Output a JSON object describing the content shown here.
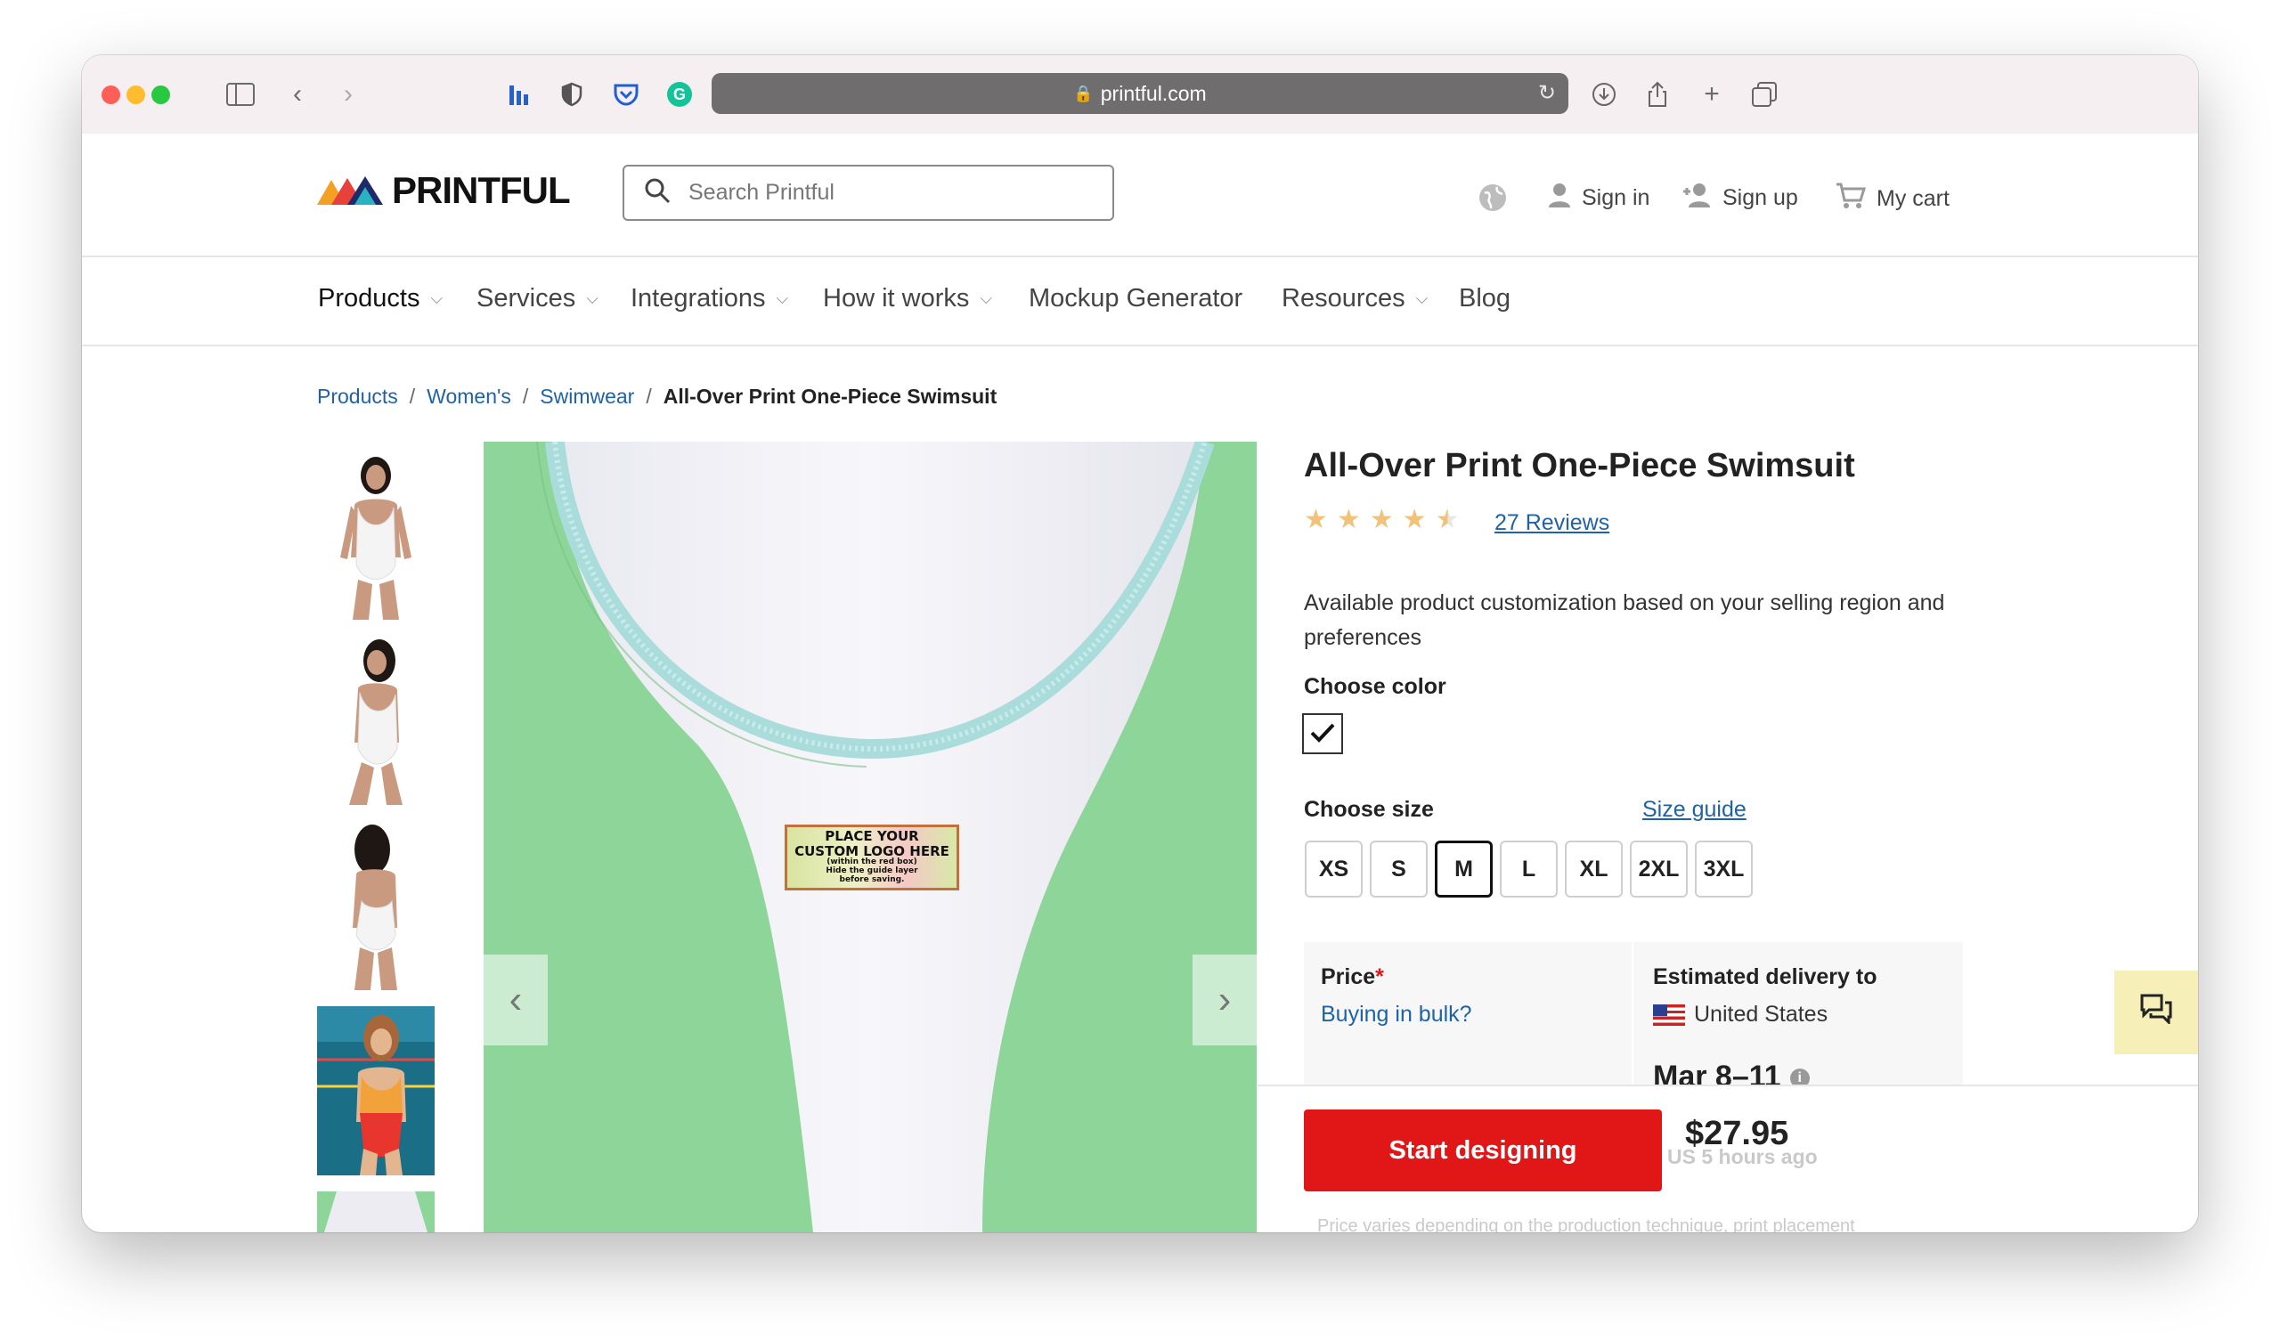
{
  "browser": {
    "url": "printful.com",
    "traffic_lights": [
      "#ff5f57",
      "#febc2e",
      "#28c840"
    ]
  },
  "header": {
    "logo_text": "PRINTFUL",
    "search_placeholder": "Search Printful",
    "sign_in": "Sign in",
    "sign_up": "Sign up",
    "cart": "My cart"
  },
  "nav": {
    "items": [
      {
        "label": "Products",
        "has_dropdown": true
      },
      {
        "label": "Services",
        "has_dropdown": true
      },
      {
        "label": "Integrations",
        "has_dropdown": true
      },
      {
        "label": "How it works",
        "has_dropdown": true
      },
      {
        "label": "Mockup Generator",
        "has_dropdown": false
      },
      {
        "label": "Resources",
        "has_dropdown": true
      },
      {
        "label": "Blog",
        "has_dropdown": false
      }
    ]
  },
  "breadcrumb": {
    "items": [
      "Products",
      "Women's",
      "Swimwear"
    ],
    "current": "All-Over Print One-Piece Swimsuit"
  },
  "gallery": {
    "print_area_line1": "PLACE YOUR",
    "print_area_line2": "CUSTOM LOGO HERE",
    "print_area_line3": "(within the red box)",
    "print_area_line4": "Hide the guide layer",
    "print_area_line5": "before saving."
  },
  "product": {
    "title": "All-Over Print One-Piece Swimsuit",
    "rating": 4.5,
    "reviews": "27 Reviews",
    "availability": "Available product customization based on your selling region and preferences",
    "choose_color_label": "Choose color",
    "selected_color": "#ffffff",
    "choose_size_label": "Choose size",
    "size_guide": "Size guide",
    "sizes": [
      "XS",
      "S",
      "M",
      "L",
      "XL",
      "2XL",
      "3XL"
    ],
    "selected_size": "M",
    "price_label": "Price",
    "bulk_link": "Buying in bulk?",
    "delivery_label": "Estimated delivery to",
    "delivery_country": "United States",
    "delivery_date": "Mar 8–11",
    "start_button": "Start designing",
    "price": "$27.95",
    "updated_text": "US 5 hours ago",
    "price_note": "Price varies depending on the production technique, print placement"
  },
  "colors": {
    "accent_red": "#e11616",
    "link_blue": "#1f63a6",
    "star": "#f0c27a",
    "swimsuit_green": "#8ed59a"
  }
}
